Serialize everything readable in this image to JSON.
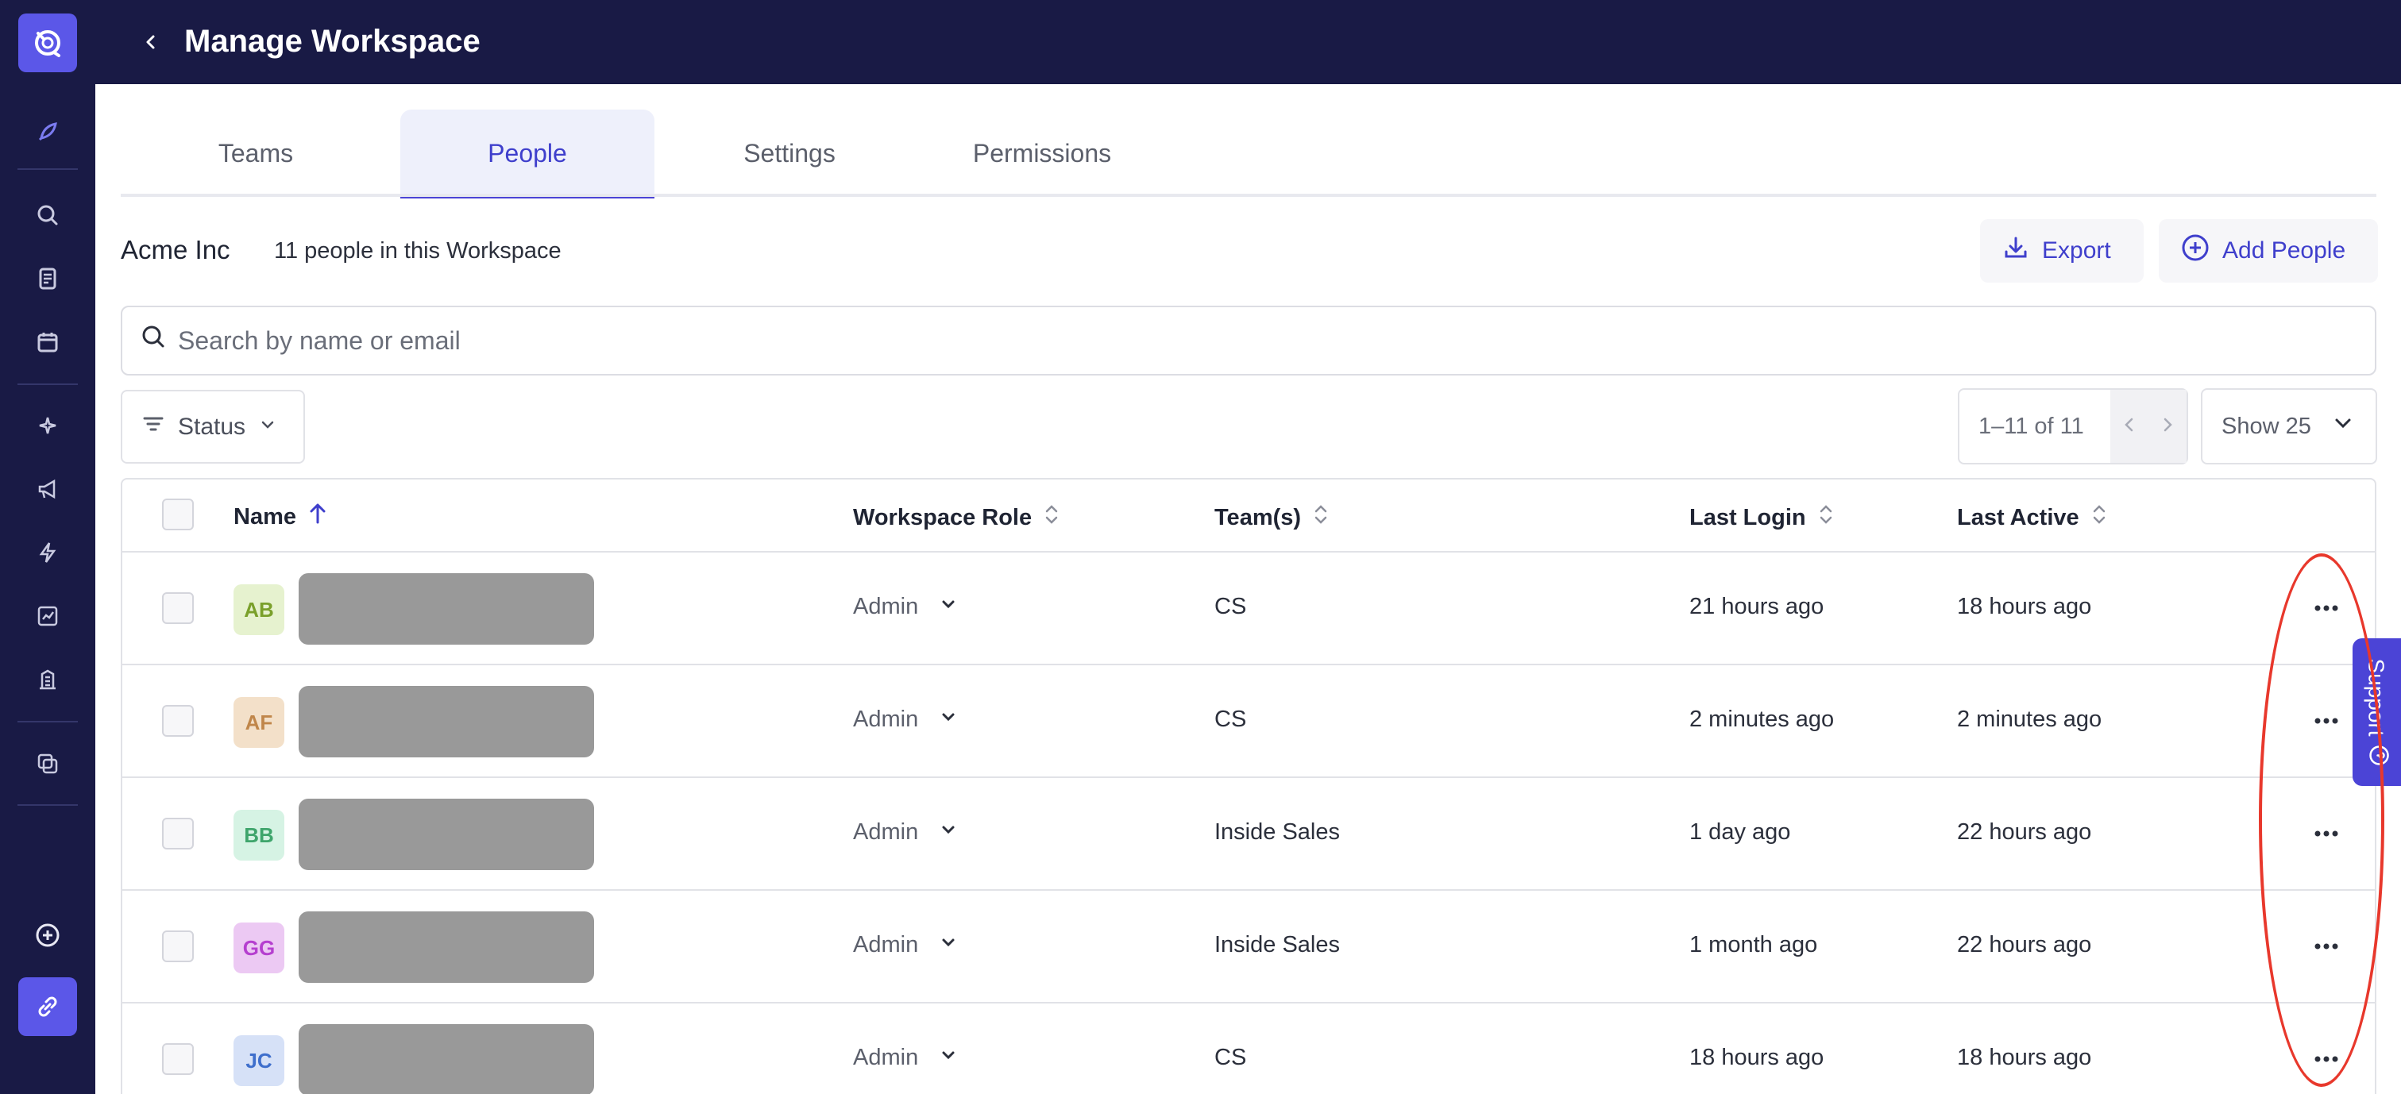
{
  "header": {
    "title": "Manage Workspace"
  },
  "tabs": [
    {
      "label": "Teams"
    },
    {
      "label": "People"
    },
    {
      "label": "Settings"
    },
    {
      "label": "Permissions"
    }
  ],
  "toolbar": {
    "org_name": "Acme Inc",
    "people_count": "11 people in this Workspace",
    "export_label": "Export",
    "add_people_label": "Add People"
  },
  "search": {
    "placeholder": "Search by name or email"
  },
  "filters": {
    "status_label": "Status",
    "range": "1–11 of 11",
    "show_label": "Show 25"
  },
  "table": {
    "columns": [
      "Name",
      "Workspace Role",
      "Team(s)",
      "Last Login",
      "Last Active"
    ],
    "rows": [
      {
        "initials": "AB",
        "role": "Admin",
        "team": "CS",
        "last_login": "21 hours ago",
        "last_active": "18 hours ago",
        "avatar_bg": "#e6f2cf",
        "avatar_fg": "#7aa02b"
      },
      {
        "initials": "AF",
        "role": "Admin",
        "team": "CS",
        "last_login": "2 minutes ago",
        "last_active": "2 minutes ago",
        "avatar_bg": "#f3e0c9",
        "avatar_fg": "#c0864a"
      },
      {
        "initials": "BB",
        "role": "Admin",
        "team": "Inside Sales",
        "last_login": "1 day ago",
        "last_active": "22 hours ago",
        "avatar_bg": "#d6f3e4",
        "avatar_fg": "#3fa56c"
      },
      {
        "initials": "GG",
        "role": "Admin",
        "team": "Inside Sales",
        "last_login": "1 month ago",
        "last_active": "22 hours ago",
        "avatar_bg": "#ecc9f3",
        "avatar_fg": "#b53fcf"
      },
      {
        "initials": "JC",
        "role": "Admin",
        "team": "CS",
        "last_login": "18 hours ago",
        "last_active": "18 hours ago",
        "avatar_bg": "#d6e1f7",
        "avatar_fg": "#3f6fcc"
      }
    ]
  },
  "support": {
    "label": "Support"
  },
  "colors": {
    "rail": "#191a45",
    "accent": "#4b44d6",
    "annotation": "#e8382c"
  },
  "icons": {
    "rail": [
      "logo-icon",
      "rocket-icon",
      "search-icon",
      "document-icon",
      "calendar-icon",
      "sparkle-icon",
      "megaphone-icon",
      "lightning-icon",
      "analytics-icon",
      "building-icon",
      "copy-icon",
      "plus-circle-icon",
      "link-icon"
    ]
  }
}
